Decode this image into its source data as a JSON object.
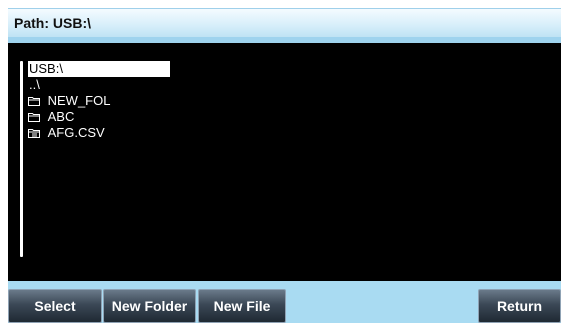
{
  "header": {
    "path_text": "Path: USB:\\"
  },
  "file_list": {
    "items": [
      {
        "name": "USB:\\",
        "icon": "",
        "selected": true
      },
      {
        "name": "..\\",
        "icon": "",
        "selected": false
      },
      {
        "name": "NEW_FOL",
        "icon": "folder-icon",
        "selected": false
      },
      {
        "name": "ABC",
        "icon": "folder-icon",
        "selected": false
      },
      {
        "name": "AFG.CSV",
        "icon": "file-icon",
        "selected": false
      }
    ]
  },
  "softkeys": {
    "select_label": "Select",
    "new_folder_label": "New Folder",
    "new_file_label": "New File",
    "return_label": "Return"
  },
  "colors": {
    "panel_background": "#000000",
    "list_text": "#ffffff",
    "selection_highlight": "#ffffff",
    "softkey_bar": "#a9dbf2",
    "header_background": "#d6eefa"
  }
}
